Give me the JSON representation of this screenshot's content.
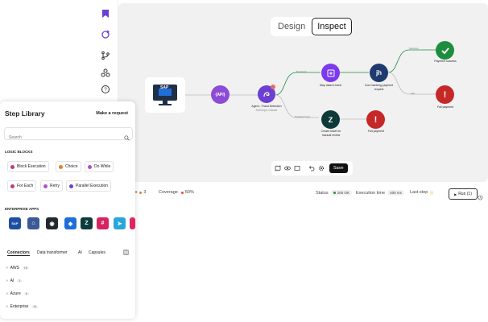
{
  "canvas": {
    "mode_toggle": {
      "design": "Design",
      "inspect": "Inspect"
    },
    "nodes": {
      "sap": "SAP",
      "api": "{API}",
      "agent": "Agent - Fraud Detection",
      "agent_sub": "Anthropic Claude",
      "map": "Map data to bank",
      "bank": "Core banking payment request",
      "success": "Payment success",
      "fail1": "Fail payment",
      "zendesk": "Create ticket for manual review",
      "fail2": "Fail payment"
    },
    "edge_labels": {
      "not_fraud": "Not fraud",
      "possible_fraud": "Possible fraud",
      "success": "Success",
      "fail": "Fail"
    },
    "toolbar": {
      "save": "Save"
    }
  },
  "statusbar": {
    "items_label": "ems",
    "items_count": "3",
    "coverage_label": "Coverage",
    "coverage_value": "50%",
    "status_label": "Status",
    "status_value": "200 OK",
    "exec_label": "Execution time",
    "exec_value": "400 ms",
    "last_step_label": "Last step",
    "run_label": "Run (1)"
  },
  "panel": {
    "title": "Step Library",
    "make_request": "Make a request",
    "search_placeholder": "Search",
    "logic_title": "LOGIC BLOCKS",
    "logic": [
      "Block Execution",
      "Choice",
      "Do While",
      "For Each",
      "Retry",
      "Parallel Execution"
    ],
    "enterprise_title": "ENTERPRISE APPS",
    "apps": [
      "SAP",
      "Oracle",
      "GitHub",
      "Jira",
      "Zendesk",
      "Slack",
      "Telegram",
      "Other"
    ],
    "tabs": [
      "Connectors",
      "Data transformer",
      "AI",
      "Capsules"
    ],
    "tree": [
      {
        "label": "AWS",
        "count": "15"
      },
      {
        "label": "AI",
        "count": "3"
      },
      {
        "label": "Azure",
        "count": "6"
      },
      {
        "label": "Enterprise",
        "count": "14"
      }
    ]
  },
  "colors": {
    "purple": "#6b3fd1",
    "accent_green": "#1e8e3e",
    "red": "#c62828"
  }
}
